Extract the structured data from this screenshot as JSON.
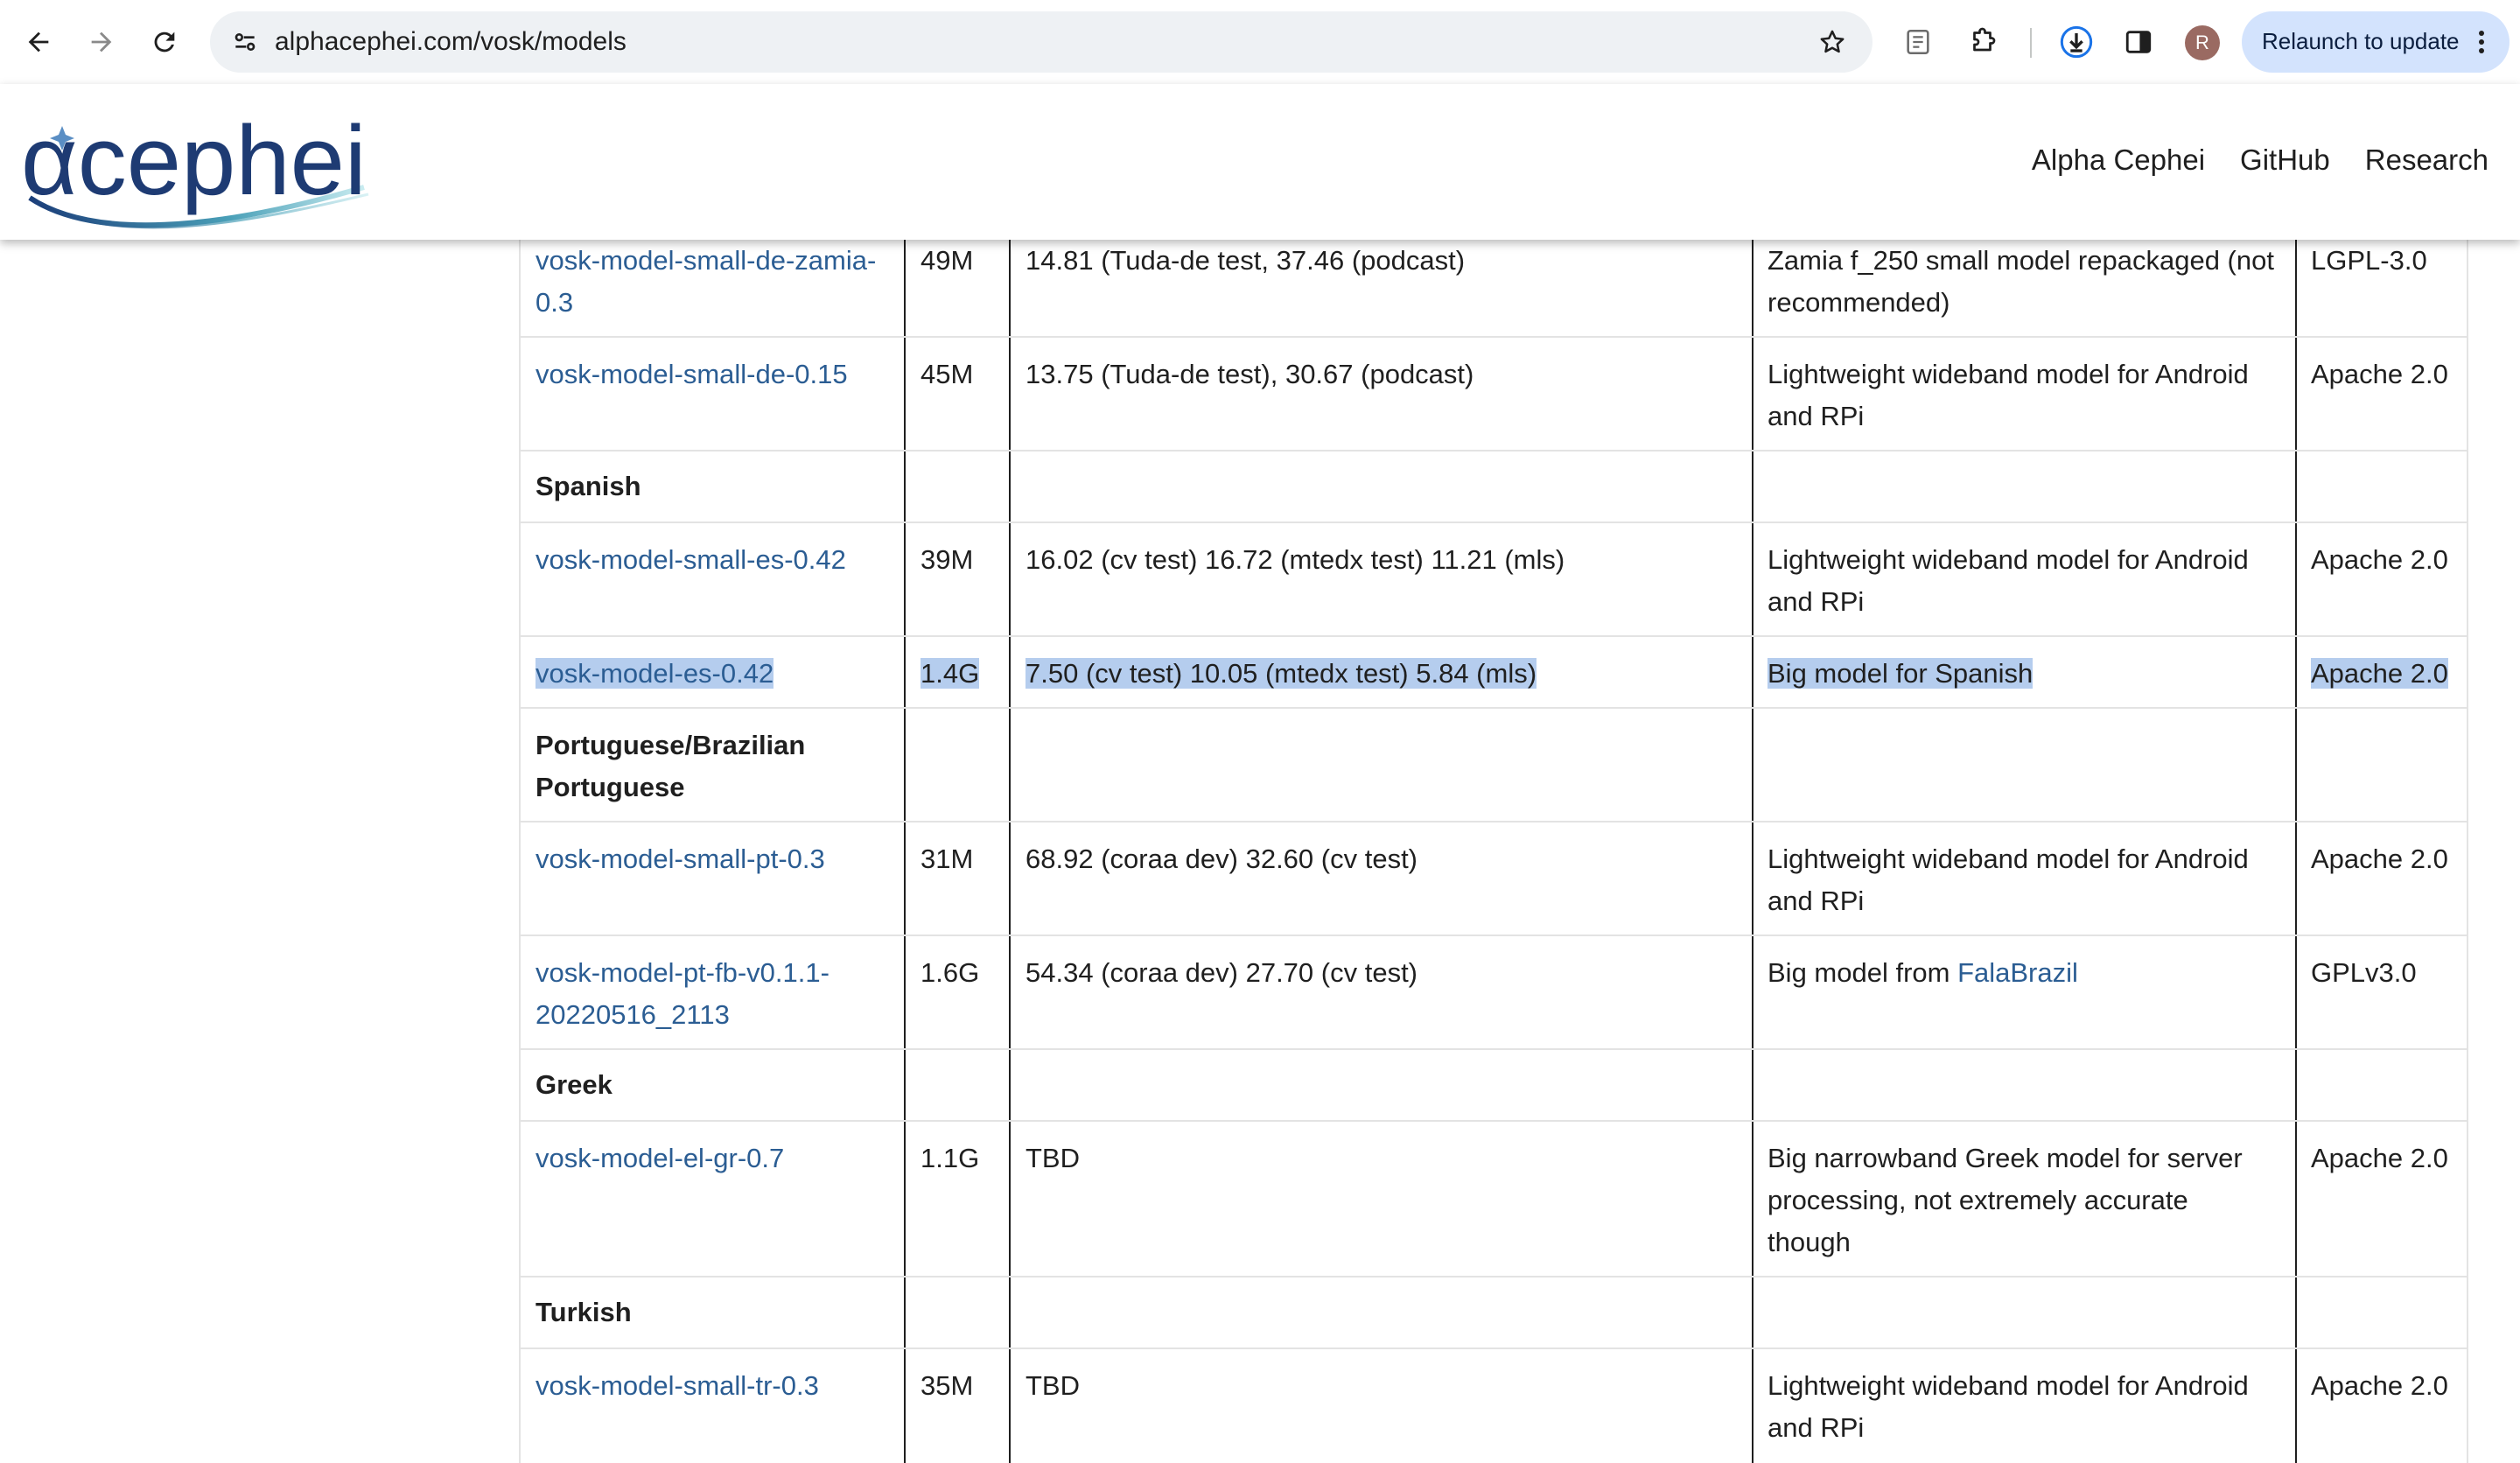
{
  "browser": {
    "url": "alphacephei.com/vosk/models",
    "avatar_letter": "R",
    "relaunch_label": "Relaunch to update"
  },
  "site": {
    "logo_text": "αcephei",
    "nav": [
      "Alpha Cephei",
      "GitHub",
      "Research"
    ]
  },
  "table": {
    "rows": [
      {
        "model": "vosk-model-small-de-zamia-0.3",
        "size": "49M",
        "wer": "14.81 (Tuda-de test, 37.46 (podcast)",
        "notes": "Zamia f_250 small model repackaged (not recommended)",
        "license": "LGPL-3.0"
      },
      {
        "model": "vosk-model-small-de-0.15",
        "size": "45M",
        "wer": "13.75 (Tuda-de test), 30.67 (podcast)",
        "notes": "Lightweight wideband model for Android and RPi",
        "license": "Apache 2.0"
      },
      {
        "heading": "Spanish"
      },
      {
        "model": "vosk-model-small-es-0.42",
        "size": "39M",
        "wer": "16.02 (cv test) 16.72 (mtedx test) 11.21 (mls)",
        "notes": "Lightweight wideband model for Android and RPi",
        "license": "Apache 2.0"
      },
      {
        "model": "vosk-model-es-0.42",
        "size": "1.4G",
        "wer": "7.50 (cv test) 10.05 (mtedx test) 5.84 (mls)",
        "notes": "Big model for Spanish",
        "license": "Apache 2.0"
      },
      {
        "heading": "Portuguese/Brazilian Portuguese"
      },
      {
        "model": "vosk-model-small-pt-0.3",
        "size": "31M",
        "wer": "68.92 (coraa dev) 32.60 (cv test)",
        "notes": "Lightweight wideband model for Android and RPi",
        "license": "Apache 2.0"
      },
      {
        "model": "vosk-model-pt-fb-v0.1.1-20220516_2113",
        "size": "1.6G",
        "wer": "54.34 (coraa dev) 27.70 (cv test)",
        "notes_prefix": "Big model from ",
        "notes_link": "FalaBrazil",
        "license": "GPLv3.0"
      },
      {
        "heading": "Greek"
      },
      {
        "model": "vosk-model-el-gr-0.7",
        "size": "1.1G",
        "wer": "TBD",
        "notes": "Big narrowband Greek model for server processing, not extremely accurate though",
        "license": "Apache 2.0"
      },
      {
        "heading": "Turkish"
      },
      {
        "model": "vosk-model-small-tr-0.3",
        "size": "35M",
        "wer": "TBD",
        "notes": "Lightweight wideband model for Android and RPi",
        "license": "Apache 2.0"
      }
    ]
  }
}
